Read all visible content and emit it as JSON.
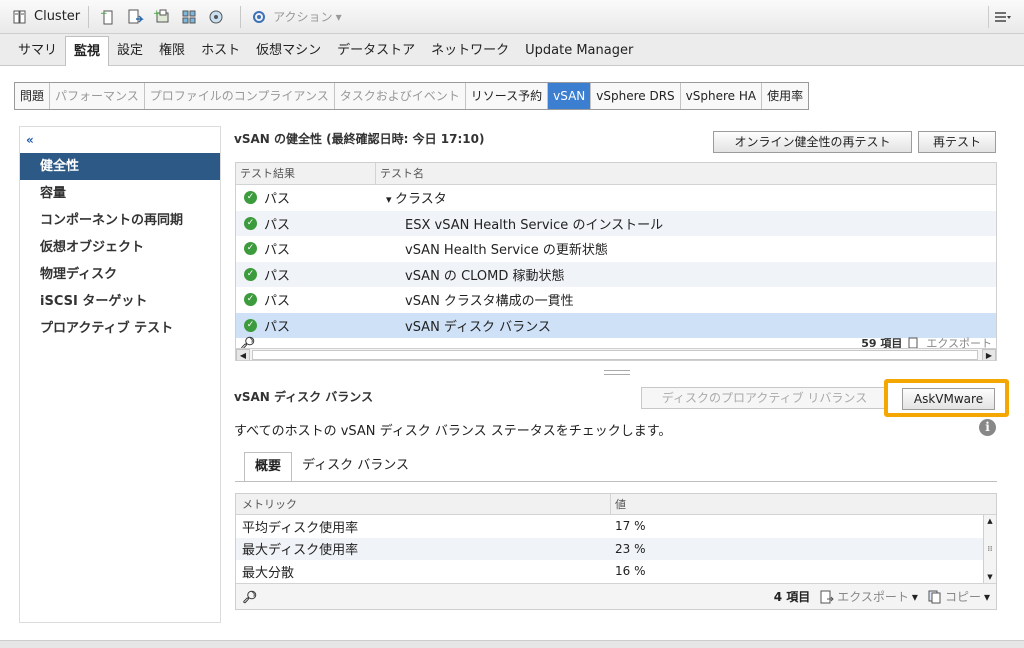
{
  "toolbar": {
    "title": "Cluster",
    "actions_label": "アクション",
    "actions_caret": "▾"
  },
  "main_tabs": [
    "サマリ",
    "監視",
    "設定",
    "権限",
    "ホスト",
    "仮想マシン",
    "データストア",
    "ネットワーク",
    "Update Manager"
  ],
  "main_tabs_active": "監視",
  "sub_tabs": [
    "問題",
    "パフォーマンス",
    "プロファイルのコンプライアンス",
    "タスクおよびイベント",
    "リソース予約",
    "vSAN",
    "vSphere DRS",
    "vSphere HA",
    "使用率"
  ],
  "sub_tabs_active": "vSAN",
  "left_nav": {
    "collapse_glyph": "«",
    "items": [
      "健全性",
      "容量",
      "コンポーネントの再同期",
      "仮想オブジェクト",
      "物理ディスク",
      "iSCSI ターゲット",
      "プロアクティブ テスト"
    ],
    "active": "健全性"
  },
  "health": {
    "header": "vSAN の健全性 (最終確認日時: 今日 17:10)",
    "retest_online": "オンライン健全性の再テスト",
    "retest": "再テスト",
    "columns": [
      "テスト結果",
      "テスト名"
    ],
    "rows": [
      {
        "result": "パス",
        "name": "クラスタ"
      },
      {
        "result": "パス",
        "name": "ESX vSAN Health Service のインストール"
      },
      {
        "result": "パス",
        "name": "vSAN Health Service の更新状態"
      },
      {
        "result": "パス",
        "name": "vSAN の CLOMD 稼動状態"
      },
      {
        "result": "パス",
        "name": "vSAN クラスタ構成の一貫性"
      },
      {
        "result": "パス",
        "name": "vSAN ディスク バランス"
      }
    ],
    "footer_count": "59 項目",
    "footer_export": "エクスポート"
  },
  "detail": {
    "title": "vSAN ディスク バランス",
    "proactive_rebalance": "ディスクのプロアクティブ リバランス",
    "askvmware": "AskVMware",
    "description": "すべてのホストの vSAN ディスク バランス ステータスをチェックします。",
    "tabs": [
      "概要",
      "ディスク バランス"
    ],
    "tabs_active": "概要",
    "columns": [
      "メトリック",
      "値"
    ],
    "rows": [
      {
        "metric": "平均ディスク使用率",
        "value": "17 %"
      },
      {
        "metric": "最大ディスク使用率",
        "value": "23 %"
      },
      {
        "metric": "最大分散",
        "value": "16 %"
      }
    ],
    "footer_count": "4 項目",
    "footer_export": "エクスポート",
    "footer_copy": "コピー"
  },
  "colors": {
    "active_nav": "#2d5986",
    "active_subtab": "#3c7fd1",
    "highlight": "#f4a700",
    "pass_icon": "#3c9b3c"
  }
}
